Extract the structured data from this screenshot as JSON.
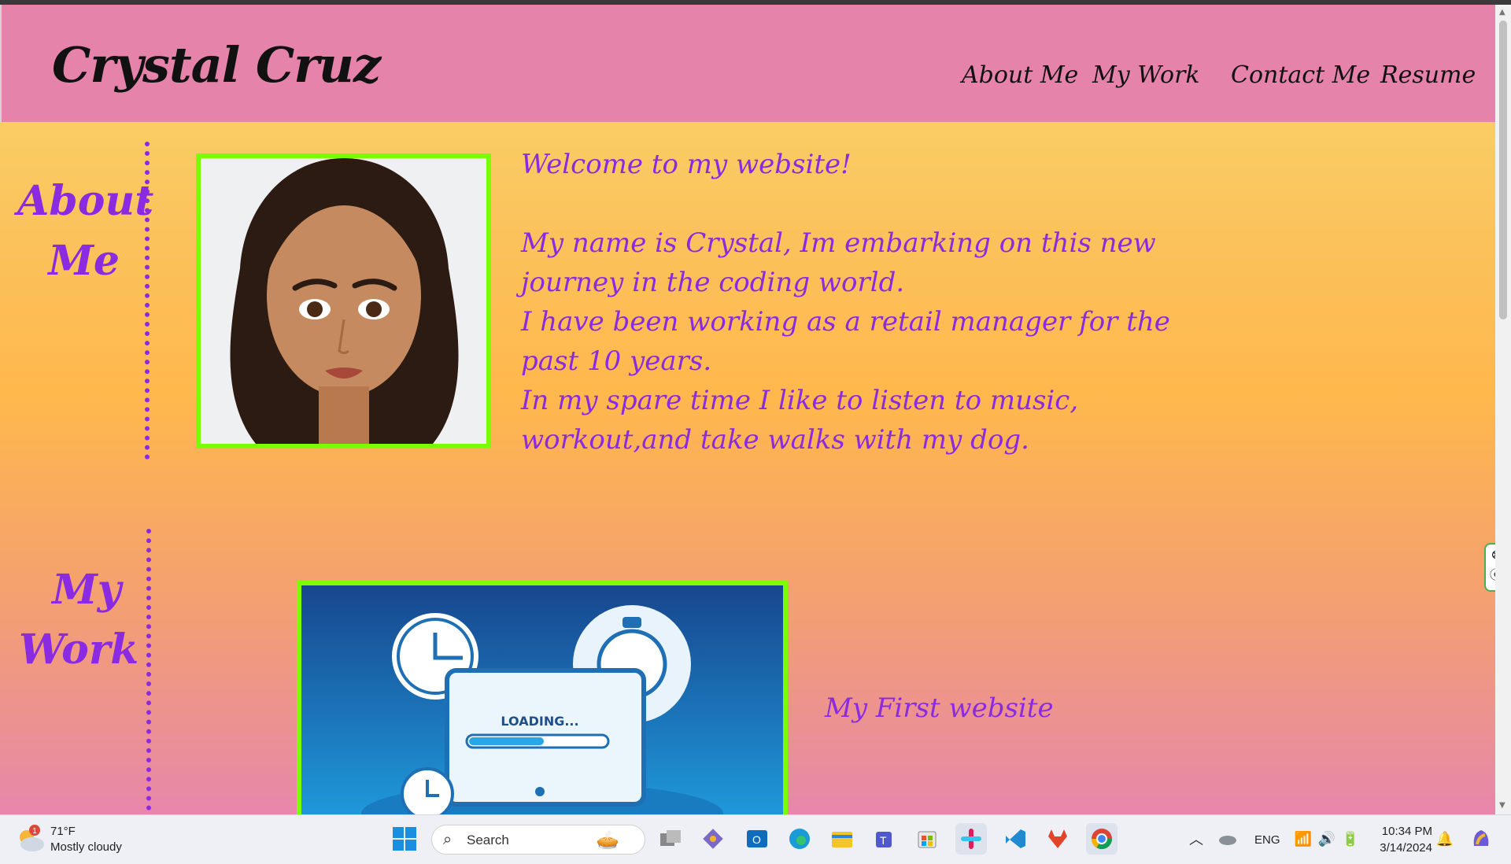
{
  "header": {
    "brand": "Crystal Cruz",
    "nav": [
      "About Me",
      "My Work",
      "Contact Me",
      "Resume"
    ]
  },
  "about": {
    "title_line1": "About",
    "title_line2": "Me",
    "welcome": "Welcome to my website!",
    "paragraph1": "My name is Crystal, Im embarking on this new journey in the coding world.",
    "paragraph2": "I have been working as a retail manager for the past 10 years.",
    "paragraph3": "In my spare time I like to listen to music, workout,and take walks with my dog."
  },
  "work": {
    "title_line1": "My",
    "title_line2": "Work",
    "caption": "My First website",
    "image_text": "LOADING..."
  },
  "taskbar": {
    "weather_badge": "1",
    "temperature": "71°F",
    "condition": "Mostly cloudy",
    "search_label": "Search",
    "language": "ENG",
    "time": "10:34 PM",
    "date": "3/14/2024"
  },
  "colors": {
    "accent": "#8a2be2",
    "frame": "#7cfc00",
    "header": "#e583ab"
  }
}
